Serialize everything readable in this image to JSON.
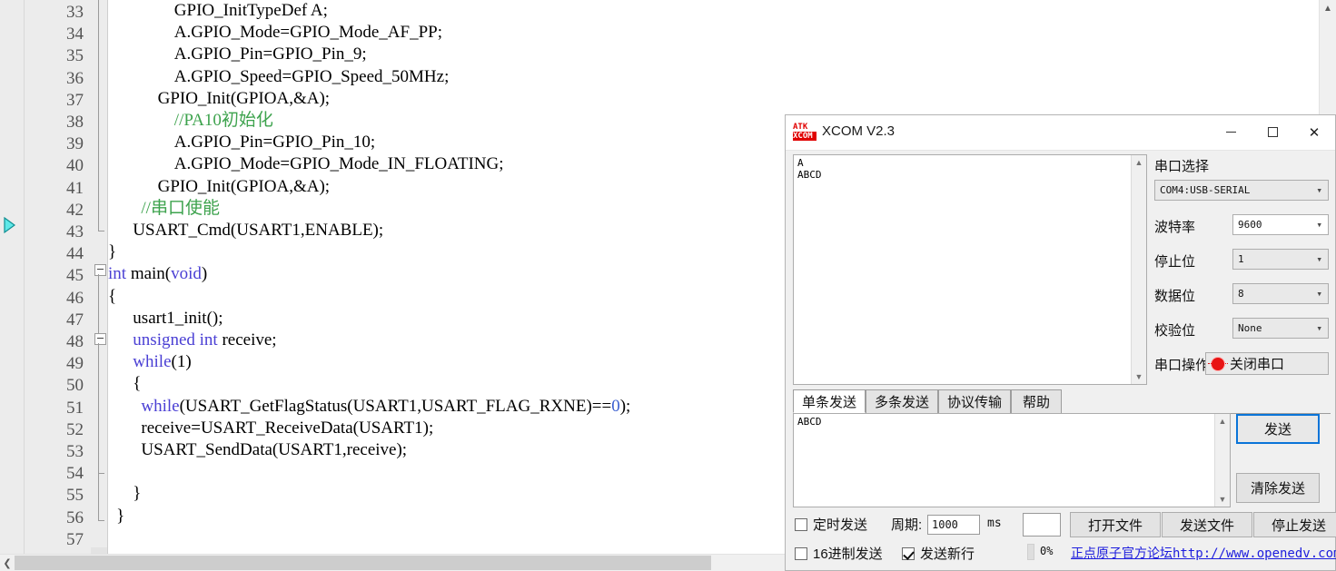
{
  "editor": {
    "first_line_number": 33,
    "current_line_marker": 43,
    "lines": [
      {
        "n": 33,
        "indent": 8,
        "segments": [
          {
            "t": "GPIO_InitTypeDef A;",
            "c": "plain"
          }
        ]
      },
      {
        "n": 34,
        "indent": 8,
        "segments": [
          {
            "t": "A.GPIO_Mode=GPIO_Mode_AF_PP;",
            "c": "plain"
          }
        ]
      },
      {
        "n": 35,
        "indent": 8,
        "segments": [
          {
            "t": "A.GPIO_Pin=GPIO_Pin_9;",
            "c": "plain"
          }
        ]
      },
      {
        "n": 36,
        "indent": 8,
        "segments": [
          {
            "t": "A.GPIO_Speed=GPIO_Speed_50MHz;",
            "c": "plain"
          }
        ]
      },
      {
        "n": 37,
        "indent": 6,
        "segments": [
          {
            "t": "GPIO_Init(GPIOA,&A);",
            "c": "plain"
          }
        ]
      },
      {
        "n": 38,
        "indent": 8,
        "segments": [
          {
            "t": "//PA10初始化",
            "c": "cmt"
          }
        ]
      },
      {
        "n": 39,
        "indent": 8,
        "segments": [
          {
            "t": "A.GPIO_Pin=GPIO_Pin_10;",
            "c": "plain"
          }
        ]
      },
      {
        "n": 40,
        "indent": 8,
        "segments": [
          {
            "t": "A.GPIO_Mode=GPIO_Mode_IN_FLOATING;",
            "c": "plain"
          }
        ]
      },
      {
        "n": 41,
        "indent": 6,
        "segments": [
          {
            "t": "GPIO_Init(GPIOA,&A);",
            "c": "plain"
          }
        ]
      },
      {
        "n": 42,
        "indent": 4,
        "segments": [
          {
            "t": "//串口使能",
            "c": "cmt"
          }
        ]
      },
      {
        "n": 43,
        "indent": 3,
        "segments": [
          {
            "t": "USART_Cmd(USART1,ENABLE);",
            "c": "plain"
          }
        ]
      },
      {
        "n": 44,
        "indent": 0,
        "segments": [
          {
            "t": "}",
            "c": "plain"
          }
        ]
      },
      {
        "n": 45,
        "indent": 0,
        "segments": [
          {
            "t": "int ",
            "c": "kw"
          },
          {
            "t": "main(",
            "c": "plain"
          },
          {
            "t": "void",
            "c": "kw"
          },
          {
            "t": ")",
            "c": "plain"
          }
        ]
      },
      {
        "n": 46,
        "indent": 0,
        "segments": [
          {
            "t": "{",
            "c": "plain"
          }
        ]
      },
      {
        "n": 47,
        "indent": 3,
        "segments": [
          {
            "t": "usart1_init();",
            "c": "plain"
          }
        ]
      },
      {
        "n": 48,
        "indent": 3,
        "segments": [
          {
            "t": "unsigned int ",
            "c": "kw"
          },
          {
            "t": "receive;",
            "c": "plain"
          }
        ]
      },
      {
        "n": 49,
        "indent": 3,
        "segments": [
          {
            "t": "while",
            "c": "kw"
          },
          {
            "t": "(1)",
            "c": "plain"
          }
        ]
      },
      {
        "n": 50,
        "indent": 3,
        "segments": [
          {
            "t": "{",
            "c": "plain"
          }
        ]
      },
      {
        "n": 51,
        "indent": 4,
        "segments": [
          {
            "t": "while",
            "c": "kw"
          },
          {
            "t": "(USART_GetFlagStatus(USART1,USART_FLAG_RXNE)==",
            "c": "plain"
          },
          {
            "t": "0",
            "c": "num"
          },
          {
            "t": ");",
            "c": "plain"
          }
        ]
      },
      {
        "n": 52,
        "indent": 4,
        "segments": [
          {
            "t": "receive=USART_ReceiveData(USART1);",
            "c": "plain"
          }
        ]
      },
      {
        "n": 53,
        "indent": 4,
        "segments": [
          {
            "t": "USART_SendData(USART1,receive);",
            "c": "plain"
          }
        ]
      },
      {
        "n": 54,
        "indent": 0,
        "segments": []
      },
      {
        "n": 55,
        "indent": 3,
        "segments": [
          {
            "t": "}",
            "c": "plain"
          }
        ]
      },
      {
        "n": 56,
        "indent": 1,
        "segments": [
          {
            "t": "}",
            "c": "plain"
          }
        ]
      },
      {
        "n": 57,
        "indent": 0,
        "segments": []
      }
    ],
    "colors": {
      "keyword": "#4a3fd4",
      "comment": "#3ea34e",
      "number": "#3b5fd0",
      "gutter_bg": "#ececec",
      "marker": "#3fe3e3"
    }
  },
  "xcom": {
    "title": "XCOM V2.3",
    "logo_line1": "ATK",
    "logo_line2": "XCOM",
    "window_buttons": {
      "minimize": "minimize-icon",
      "maximize": "maximize-icon",
      "close": "✕"
    },
    "receive": {
      "text": "A\nABCD"
    },
    "settings": {
      "section_title": "串口选择",
      "port": {
        "value": "COM4:USB-SERIAL"
      },
      "rows": [
        {
          "label": "波特率",
          "value": "9600",
          "white": true
        },
        {
          "label": "停止位",
          "value": "1",
          "white": false
        },
        {
          "label": "数据位",
          "value": "8",
          "white": false
        },
        {
          "label": "校验位",
          "value": "None",
          "white": false
        }
      ],
      "operation_label": "串口操作",
      "operation_button": "关闭串口"
    },
    "tabs": [
      {
        "label": "单条发送",
        "active": true
      },
      {
        "label": "多条发送",
        "active": false
      },
      {
        "label": "协议传输",
        "active": false
      },
      {
        "label": "帮助",
        "active": false
      }
    ],
    "send": {
      "text": "ABCD",
      "send_button": "发送",
      "clear_button": "清除发送"
    },
    "bottom": {
      "timed_send_label": "定时发送",
      "timed_send_checked": false,
      "period_label": "周期:",
      "period_value": "1000",
      "period_unit": "ms",
      "blank_input_value": "",
      "open_file_button": "打开文件",
      "send_file_button": "发送文件",
      "stop_send_button": "停止发送",
      "hex_send_label": "16进制发送",
      "hex_send_checked": false,
      "newline_label": "发送新行",
      "newline_checked": true,
      "progress_text": "0%",
      "forum_link": "正点原子官方论坛http://www.openedv.com/",
      "link_color": "#1d1ddd"
    }
  }
}
